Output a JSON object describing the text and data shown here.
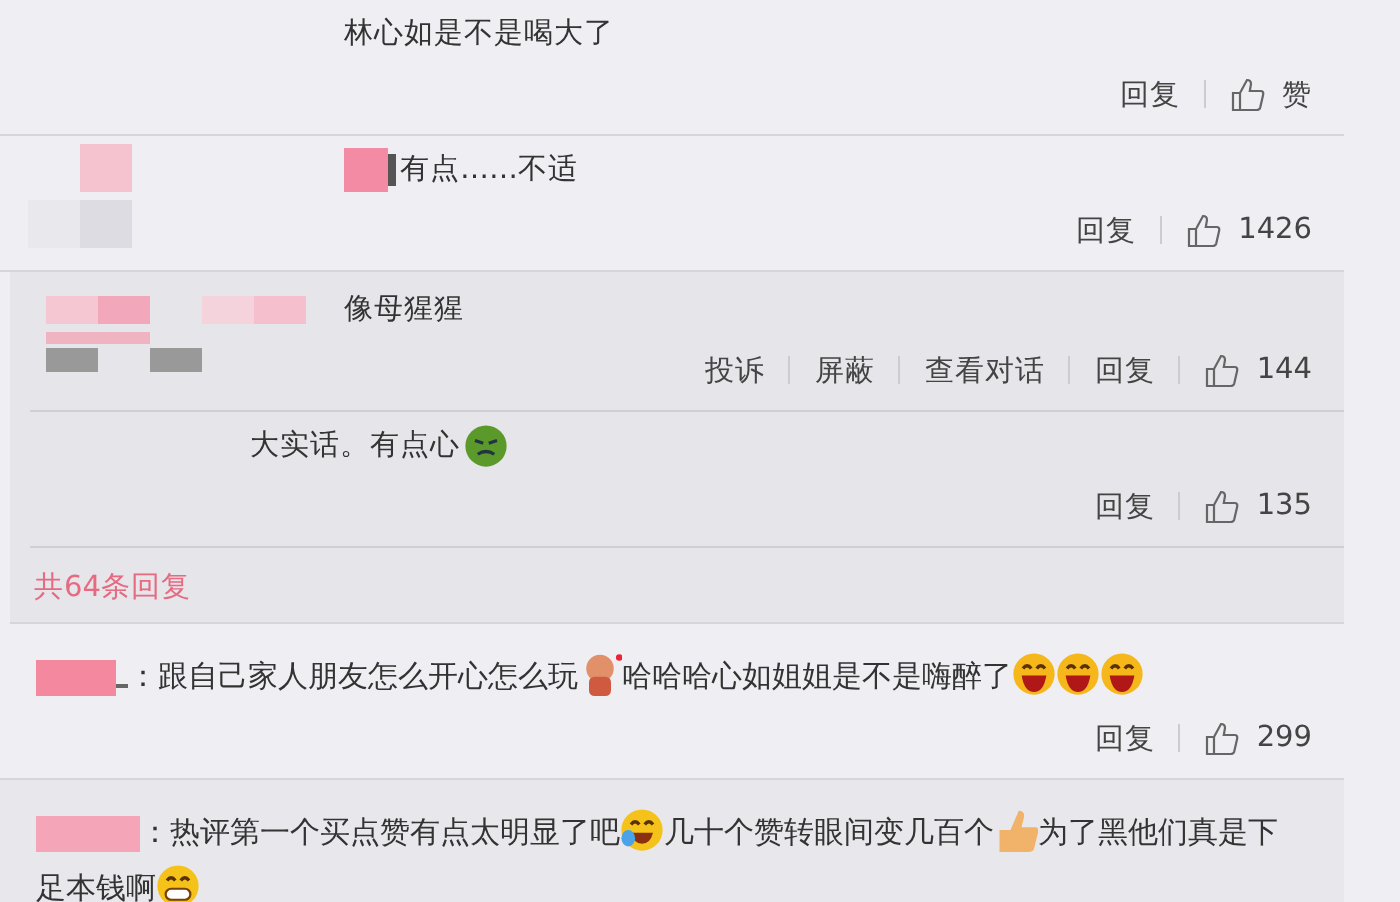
{
  "comments": [
    {
      "kind": "plain",
      "segments": [
        {
          "kind": "text",
          "text": "林心如是不是喝大了"
        }
      ],
      "actions": [
        "回复"
      ],
      "like": "赞"
    },
    {
      "kind": "tagged",
      "segments": [
        {
          "kind": "text",
          "text": "有点……不适"
        }
      ],
      "actions": [
        "回复"
      ],
      "like": "1426"
    }
  ],
  "thread": {
    "comments": [
      {
        "kind": "reply",
        "segments": [
          {
            "kind": "text",
            "text": "像母猩猩"
          }
        ],
        "actions": [
          "投诉",
          "屏蔽",
          "查看对话",
          "回复"
        ],
        "like": "144"
      },
      {
        "kind": "subreply",
        "segments": [
          {
            "kind": "text",
            "text": "大实话。有点心"
          },
          {
            "kind": "sick"
          }
        ],
        "actions": [
          "回复"
        ],
        "like": "135"
      }
    ],
    "more_link": "共64条回复"
  },
  "later_comments": [
    {
      "kind": "inline",
      "segments": [
        {
          "kind": "text",
          "text": "：跟自己家人朋友怎么开心怎么玩"
        },
        {
          "kind": "doll"
        },
        {
          "kind": "text",
          "text": "哈哈哈心如姐姐是不是嗨醉了"
        },
        {
          "kind": "laugh"
        },
        {
          "kind": "laugh"
        },
        {
          "kind": "laugh"
        }
      ],
      "actions": [
        "回复"
      ],
      "like": "299"
    },
    {
      "kind": "inline",
      "segments": [
        {
          "kind": "text",
          "text": "：热评第一个买点赞有点太明显了吧"
        },
        {
          "kind": "crylaugh"
        },
        {
          "kind": "text",
          "text": "几十个赞转眼间变几百个"
        },
        {
          "kind": "thumb"
        },
        {
          "kind": "text",
          "text": "为了黑他们真是下"
        },
        {
          "kind": "text",
          "text": "足本钱啊"
        },
        {
          "kind": "grin"
        }
      ]
    }
  ]
}
